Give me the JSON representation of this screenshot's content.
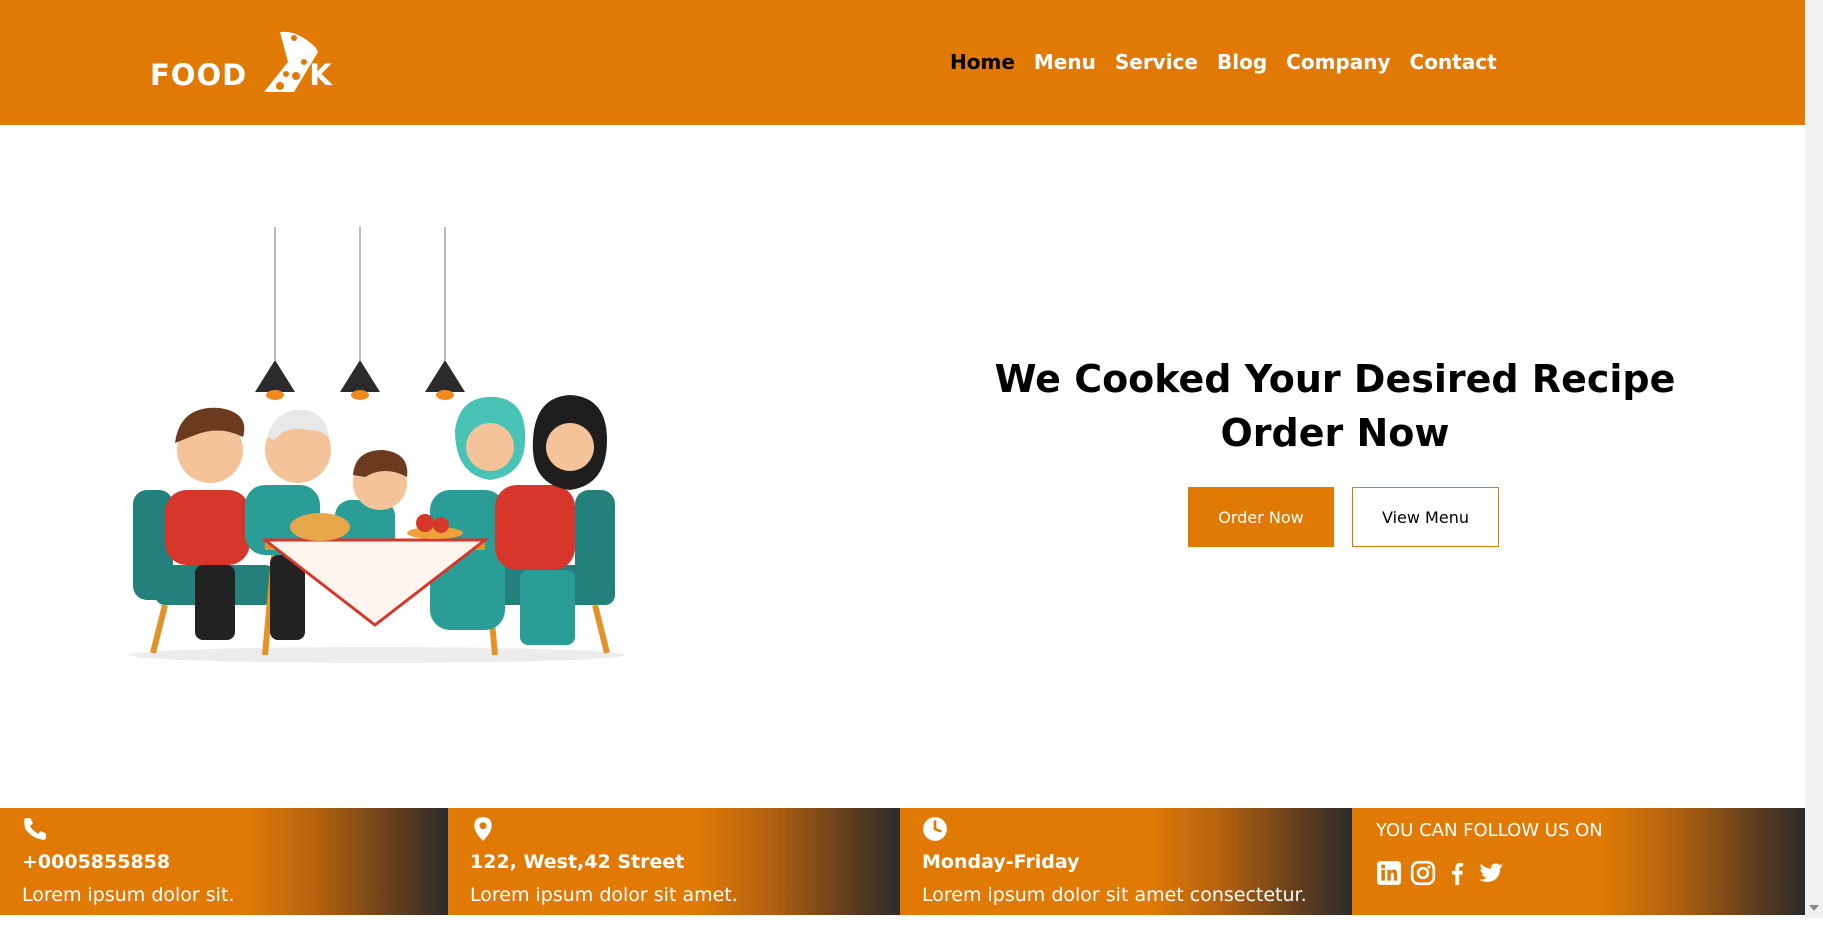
{
  "brand": {
    "name_left": "FOOD",
    "name_right": "K"
  },
  "nav": {
    "items": [
      "Home",
      "Menu",
      "Service",
      "Blog",
      "Company",
      "Contact"
    ],
    "active": "Home"
  },
  "hero": {
    "headline_line1": "We Cooked Your Desired Recipe",
    "headline_line2": "Order Now",
    "order_button": "Order Now",
    "menu_button": "View Menu",
    "illustration": "family-dining-illustration"
  },
  "info": {
    "phone": {
      "icon": "phone-icon",
      "title": "+0005855858",
      "text": "Lorem ipsum dolor sit."
    },
    "address": {
      "icon": "location-pin-icon",
      "title": "122, West,42 Street",
      "text": "Lorem ipsum dolor sit amet."
    },
    "hours": {
      "icon": "clock-icon",
      "title": "Monday-Friday",
      "text": "Lorem ipsum dolor sit amet consectetur."
    },
    "social": {
      "title": "YOU CAN FOLLOW US ON",
      "icons": [
        "linkedin-icon",
        "instagram-icon",
        "facebook-icon",
        "twitter-icon"
      ]
    }
  },
  "colors": {
    "accent": "#e07a05",
    "dark": "#2c2c2c",
    "white": "#ffffff"
  }
}
